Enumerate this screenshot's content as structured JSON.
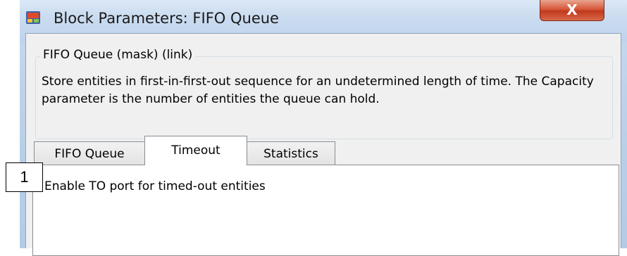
{
  "window": {
    "title": "Block Parameters: FIFO Queue",
    "close_label": "X",
    "icon": "simulink-block-icon"
  },
  "description": {
    "group_title": "FIFO Queue (mask) (link)",
    "text": "Store entities in first-in-first-out sequence for an undetermined length of time. The Capacity parameter is the number of entities the queue can hold."
  },
  "tabs": [
    {
      "label": "FIFO Queue",
      "active": false
    },
    {
      "label": "Timeout",
      "active": true
    },
    {
      "label": "Statistics",
      "active": false
    }
  ],
  "timeout_panel": {
    "checkbox_label": "Enable TO port for timed-out entities",
    "checked": false
  },
  "annotation": {
    "callout_number": "1"
  },
  "colors": {
    "titlebar": "#c6d9ee",
    "close_button": "#c8452a",
    "dialog_background": "#f0f0f0"
  }
}
